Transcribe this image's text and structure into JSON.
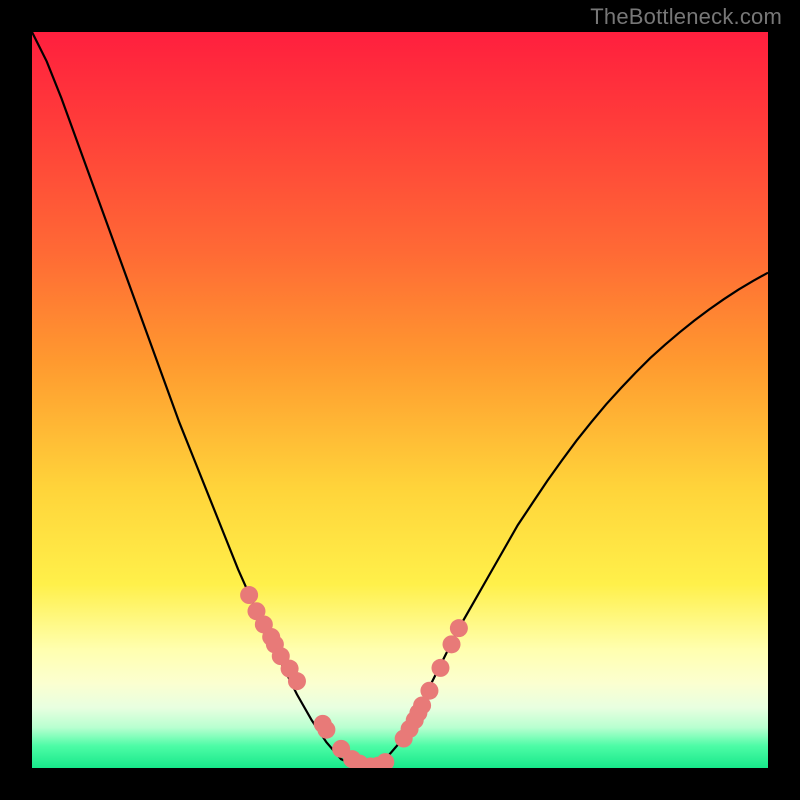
{
  "watermark": "TheBottleneck.com",
  "colors": {
    "bg": "#000000",
    "curve": "#000000",
    "dot_fill": "#e87a78",
    "dot_stroke": "#d35f5d"
  },
  "chart_data": {
    "type": "line",
    "title": "",
    "xlabel": "",
    "ylabel": "",
    "xlim": [
      0,
      1
    ],
    "ylim": [
      0,
      1
    ],
    "curve": {
      "x": [
        0.0,
        0.02,
        0.04,
        0.06,
        0.08,
        0.1,
        0.12,
        0.14,
        0.16,
        0.18,
        0.2,
        0.22,
        0.24,
        0.26,
        0.28,
        0.3,
        0.32,
        0.34,
        0.36,
        0.38,
        0.4,
        0.42,
        0.44,
        0.46,
        0.48,
        0.5,
        0.52,
        0.54,
        0.56,
        0.58,
        0.6,
        0.62,
        0.64,
        0.66,
        0.68,
        0.7,
        0.72,
        0.74,
        0.76,
        0.78,
        0.8,
        0.82,
        0.84,
        0.86,
        0.88,
        0.9,
        0.92,
        0.94,
        0.96,
        0.98,
        1.0
      ],
      "y": [
        1.0,
        0.96,
        0.91,
        0.855,
        0.8,
        0.745,
        0.69,
        0.635,
        0.58,
        0.525,
        0.47,
        0.42,
        0.37,
        0.32,
        0.27,
        0.225,
        0.18,
        0.14,
        0.1,
        0.065,
        0.035,
        0.012,
        0.003,
        0.003,
        0.012,
        0.035,
        0.07,
        0.11,
        0.15,
        0.19,
        0.225,
        0.26,
        0.295,
        0.33,
        0.36,
        0.39,
        0.418,
        0.445,
        0.47,
        0.494,
        0.516,
        0.537,
        0.557,
        0.575,
        0.592,
        0.608,
        0.623,
        0.637,
        0.65,
        0.662,
        0.673
      ]
    },
    "dots": {
      "x": [
        0.295,
        0.305,
        0.315,
        0.325,
        0.33,
        0.338,
        0.35,
        0.36,
        0.395,
        0.4,
        0.42,
        0.435,
        0.445,
        0.46,
        0.47,
        0.48,
        0.505,
        0.513,
        0.52,
        0.525,
        0.53,
        0.54,
        0.555,
        0.57,
        0.58
      ],
      "y": [
        0.235,
        0.213,
        0.195,
        0.178,
        0.168,
        0.152,
        0.135,
        0.118,
        0.06,
        0.052,
        0.026,
        0.012,
        0.006,
        0.002,
        0.003,
        0.008,
        0.04,
        0.053,
        0.065,
        0.075,
        0.085,
        0.105,
        0.136,
        0.168,
        0.19
      ]
    },
    "gradient_stops": [
      {
        "offset": 0.0,
        "color": "#ff1f3e"
      },
      {
        "offset": 0.12,
        "color": "#ff3b3a"
      },
      {
        "offset": 0.3,
        "color": "#ff6a35"
      },
      {
        "offset": 0.45,
        "color": "#ff9a2f"
      },
      {
        "offset": 0.62,
        "color": "#ffd43a"
      },
      {
        "offset": 0.75,
        "color": "#fff04a"
      },
      {
        "offset": 0.84,
        "color": "#ffffb0"
      },
      {
        "offset": 0.885,
        "color": "#fbffd0"
      },
      {
        "offset": 0.918,
        "color": "#e8ffe0"
      },
      {
        "offset": 0.945,
        "color": "#b8ffd0"
      },
      {
        "offset": 0.97,
        "color": "#4dfca6"
      },
      {
        "offset": 1.0,
        "color": "#17e88a"
      }
    ]
  }
}
